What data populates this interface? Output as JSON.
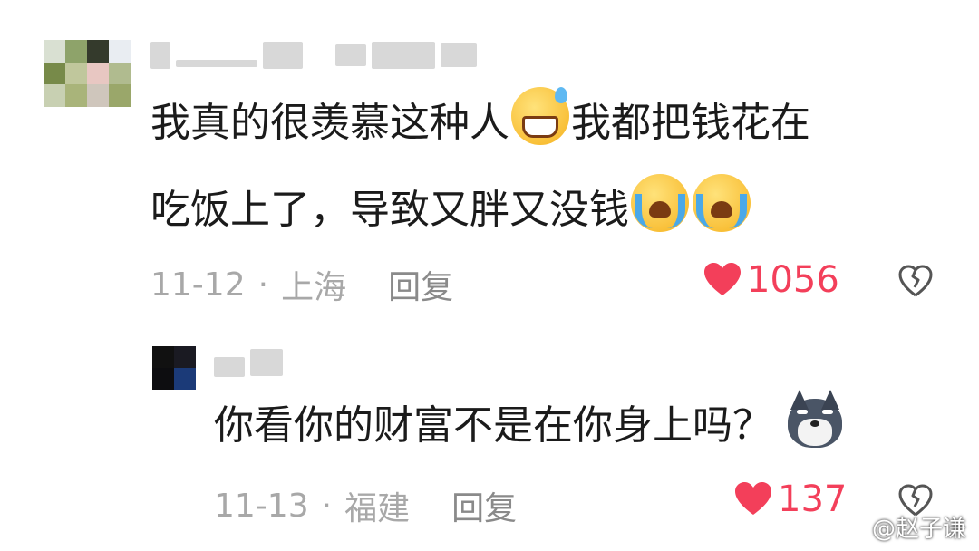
{
  "comments": [
    {
      "text_line1": "我真的很羡慕这种人",
      "text_line1b": "我都把钱花在",
      "text_line2": "吃饭上了，导致又胖又没钱",
      "emoji_1": "grinning-sweat-emoji",
      "emoji_2": "crying-emoji",
      "date": "11-12",
      "separator": "·",
      "location": "上海",
      "reply_label": "回复",
      "likes": "1056"
    },
    {
      "text": "你看你的财富不是在你身上吗？",
      "sticker": "husky-dog-icon",
      "date": "11-13",
      "separator": "·",
      "location": "福建",
      "reply_label": "回复",
      "likes": "137"
    }
  ],
  "watermark": "@赵子谦",
  "colors": {
    "like_heart": "#f33f5a",
    "meta_text": "#a8a8a8",
    "body_text": "#1b1b1b"
  }
}
